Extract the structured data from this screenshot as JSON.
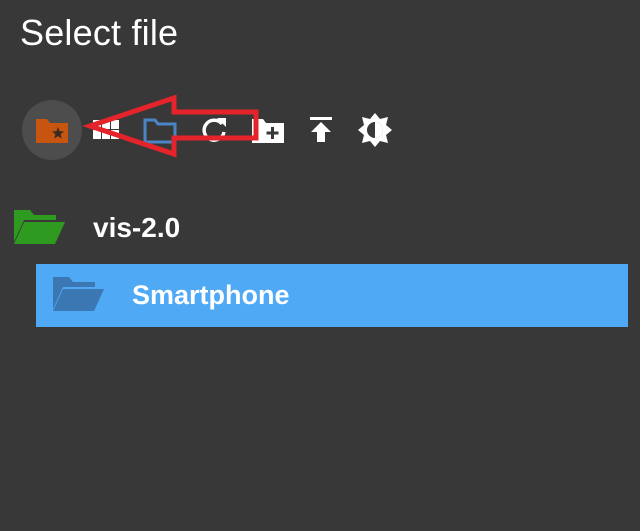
{
  "dialog": {
    "title": "Select file"
  },
  "toolbar": {
    "buttons": [
      {
        "icon": "favorite-folder-icon"
      },
      {
        "icon": "grid-view-icon"
      },
      {
        "icon": "folder-outline-icon"
      },
      {
        "icon": "refresh-icon"
      },
      {
        "icon": "add-folder-icon"
      },
      {
        "icon": "upload-icon"
      },
      {
        "icon": "brightness-icon"
      }
    ]
  },
  "tree": {
    "root": {
      "label": "vis-2.0",
      "icon": "folder-open-icon",
      "color": "#2e9a1f"
    },
    "children": [
      {
        "label": "Smartphone",
        "icon": "folder-open-icon",
        "color": "#3b77b2",
        "selected": true
      }
    ]
  },
  "colors": {
    "background": "#383838",
    "selected_row": "#4fa9f5",
    "favorite_folder": "#c8550f",
    "annotation_arrow": "#e5232a"
  }
}
